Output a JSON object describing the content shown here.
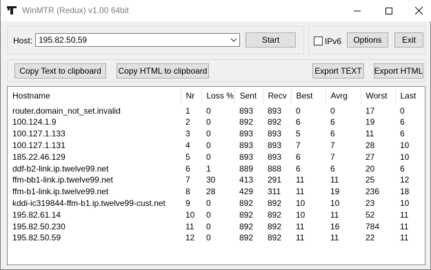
{
  "window": {
    "title": "WinMTR (Redux) v1.00 64bit"
  },
  "host_group": {
    "host_label": "Host:",
    "host_value": "195.82.50.59",
    "start_label": "Start"
  },
  "options_group": {
    "ipv6_label": "IPv6",
    "ipv6_checked": false,
    "options_label": "Options",
    "exit_label": "Exit"
  },
  "toolbar": {
    "copy_text_label": "Copy Text to clipboard",
    "copy_html_label": "Copy HTML to clipboard",
    "export_text_label": "Export TEXT",
    "export_html_label": "Export HTML"
  },
  "table": {
    "columns": [
      "Hostname",
      "Nr",
      "Loss %",
      "Sent",
      "Recv",
      "Best",
      "Avrg",
      "Worst",
      "Last"
    ],
    "rows": [
      [
        "router.domain_not_set.invalid",
        "1",
        "0",
        "893",
        "893",
        "0",
        "0",
        "17",
        "0"
      ],
      [
        "100.124.1.9",
        "2",
        "0",
        "892",
        "892",
        "6",
        "6",
        "19",
        "6"
      ],
      [
        "100.127.1.133",
        "3",
        "0",
        "893",
        "893",
        "5",
        "6",
        "11",
        "6"
      ],
      [
        "100.127.1.131",
        "4",
        "0",
        "893",
        "893",
        "7",
        "7",
        "28",
        "10"
      ],
      [
        "185.22.46.129",
        "5",
        "0",
        "893",
        "893",
        "6",
        "7",
        "27",
        "10"
      ],
      [
        "ddf-b2-link.ip.twelve99.net",
        "6",
        "1",
        "889",
        "888",
        "6",
        "6",
        "20",
        "6"
      ],
      [
        "ffm-bb1-link.ip.twelve99.net",
        "7",
        "30",
        "413",
        "291",
        "11",
        "11",
        "25",
        "12"
      ],
      [
        "ffm-b1-link.ip.twelve99.net",
        "8",
        "28",
        "429",
        "311",
        "11",
        "19",
        "236",
        "18"
      ],
      [
        "kddi-ic319844-ffm-b1.ip.twelve99-cust.net",
        "9",
        "0",
        "892",
        "892",
        "10",
        "10",
        "23",
        "10"
      ],
      [
        "195.82.61.14",
        "10",
        "0",
        "892",
        "892",
        "10",
        "11",
        "52",
        "11"
      ],
      [
        "195.82.50.230",
        "11",
        "0",
        "892",
        "892",
        "11",
        "16",
        "784",
        "11"
      ],
      [
        "195.82.50.59",
        "12",
        "0",
        "892",
        "892",
        "11",
        "11",
        "22",
        "11"
      ]
    ]
  },
  "icons": {
    "app": "app-icon",
    "minimize": "minimize-icon",
    "maximize": "maximize-icon",
    "close": "close-icon",
    "dropdown": "chevron-down-icon"
  }
}
